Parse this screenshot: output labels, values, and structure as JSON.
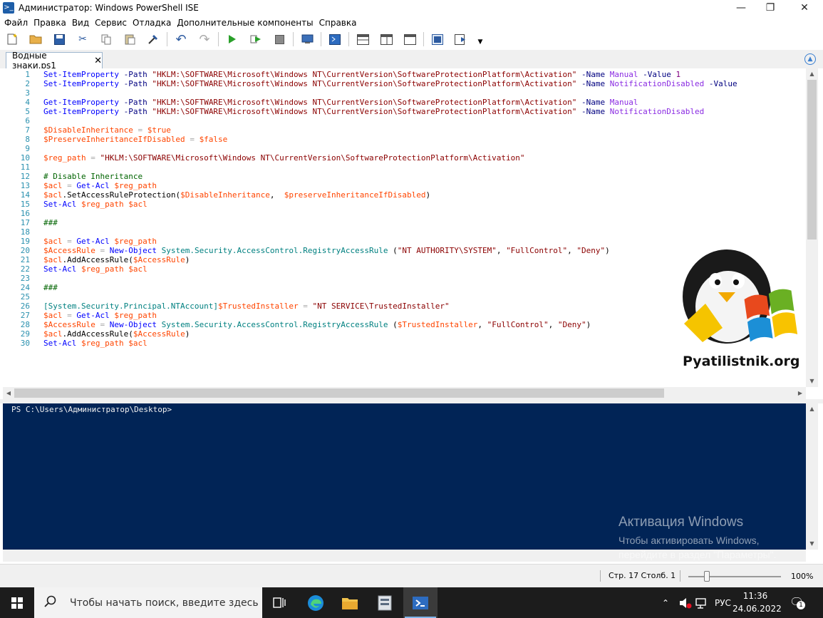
{
  "window": {
    "title": "Администратор: Windows PowerShell ISE",
    "icon": "powershell-icon",
    "controls": [
      "minimize",
      "maximize",
      "close"
    ]
  },
  "menu": [
    "Файл",
    "Правка",
    "Вид",
    "Сервис",
    "Отладка",
    "Дополнительные компоненты",
    "Справка"
  ],
  "toolbar": {
    "buttons": [
      "new",
      "open",
      "save",
      "cut",
      "copy",
      "paste",
      "clear",
      "undo",
      "redo",
      "run",
      "run-selection",
      "stop",
      "remote-powershell",
      "start-powershell",
      "show-script-top",
      "show-script-right",
      "show-script-maximized",
      "show-commands",
      "show-addon"
    ]
  },
  "tab": {
    "label": "Водные знаки.ps1",
    "close": "✕"
  },
  "editor": {
    "lines": [
      {
        "n": "1",
        "tokens": [
          [
            "cmd",
            "Set-ItemProperty"
          ],
          [
            "txt",
            " "
          ],
          [
            "par",
            "-Path"
          ],
          [
            "txt",
            " "
          ],
          [
            "str",
            "\"HKLM:\\SOFTWARE\\Microsoft\\Windows NT\\CurrentVersion\\SoftwareProtectionPlatform\\Activation\""
          ],
          [
            "txt",
            " "
          ],
          [
            "par",
            "-Name"
          ],
          [
            "txt",
            " "
          ],
          [
            "arg",
            "Manual"
          ],
          [
            "txt",
            " "
          ],
          [
            "par",
            "-Value"
          ],
          [
            "txt",
            " "
          ],
          [
            "num",
            "1"
          ]
        ]
      },
      {
        "n": "2",
        "tokens": [
          [
            "cmd",
            "Set-ItemProperty"
          ],
          [
            "txt",
            " "
          ],
          [
            "par",
            "-Path"
          ],
          [
            "txt",
            " "
          ],
          [
            "str",
            "\"HKLM:\\SOFTWARE\\Microsoft\\Windows NT\\CurrentVersion\\SoftwareProtectionPlatform\\Activation\""
          ],
          [
            "txt",
            " "
          ],
          [
            "par",
            "-Name"
          ],
          [
            "txt",
            " "
          ],
          [
            "arg",
            "NotificationDisabled"
          ],
          [
            "txt",
            " "
          ],
          [
            "par",
            "-Value"
          ]
        ]
      },
      {
        "n": "3",
        "tokens": []
      },
      {
        "n": "4",
        "tokens": [
          [
            "cmd",
            "Get-ItemProperty"
          ],
          [
            "txt",
            " "
          ],
          [
            "par",
            "-Path"
          ],
          [
            "txt",
            " "
          ],
          [
            "str",
            "\"HKLM:\\SOFTWARE\\Microsoft\\Windows NT\\CurrentVersion\\SoftwareProtectionPlatform\\Activation\""
          ],
          [
            "txt",
            " "
          ],
          [
            "par",
            "-Name"
          ],
          [
            "txt",
            " "
          ],
          [
            "arg",
            "Manual"
          ]
        ]
      },
      {
        "n": "5",
        "tokens": [
          [
            "cmd",
            "Get-ItemProperty"
          ],
          [
            "txt",
            " "
          ],
          [
            "par",
            "-Path"
          ],
          [
            "txt",
            " "
          ],
          [
            "str",
            "\"HKLM:\\SOFTWARE\\Microsoft\\Windows NT\\CurrentVersion\\SoftwareProtectionPlatform\\Activation\""
          ],
          [
            "txt",
            " "
          ],
          [
            "par",
            "-Name"
          ],
          [
            "txt",
            " "
          ],
          [
            "arg",
            "NotificationDisabled"
          ]
        ]
      },
      {
        "n": "6",
        "tokens": []
      },
      {
        "n": "7",
        "tokens": [
          [
            "var",
            "$DisableInheritance"
          ],
          [
            "txt",
            " "
          ],
          [
            "op",
            "="
          ],
          [
            "txt",
            " "
          ],
          [
            "var",
            "$true"
          ]
        ]
      },
      {
        "n": "8",
        "tokens": [
          [
            "var",
            "$PreserveInheritanceIfDisabled"
          ],
          [
            "txt",
            " "
          ],
          [
            "op",
            "="
          ],
          [
            "txt",
            " "
          ],
          [
            "var",
            "$false"
          ]
        ]
      },
      {
        "n": "9",
        "tokens": []
      },
      {
        "n": "10",
        "tokens": [
          [
            "var",
            "$reg_path"
          ],
          [
            "txt",
            " "
          ],
          [
            "op",
            "="
          ],
          [
            "txt",
            " "
          ],
          [
            "str",
            "\"HKLM:\\SOFTWARE\\Microsoft\\Windows NT\\CurrentVersion\\SoftwareProtectionPlatform\\Activation\""
          ]
        ]
      },
      {
        "n": "11",
        "tokens": []
      },
      {
        "n": "12",
        "tokens": [
          [
            "cmt",
            "# Disable Inheritance"
          ]
        ]
      },
      {
        "n": "13",
        "tokens": [
          [
            "var",
            "$acl"
          ],
          [
            "txt",
            " "
          ],
          [
            "op",
            "="
          ],
          [
            "txt",
            " "
          ],
          [
            "cmd",
            "Get-Acl"
          ],
          [
            "txt",
            " "
          ],
          [
            "var",
            "$reg_path"
          ]
        ]
      },
      {
        "n": "14",
        "tokens": [
          [
            "var",
            "$acl"
          ],
          [
            "txt",
            ".SetAccessRuleProtection("
          ],
          [
            "var",
            "$DisableInheritance"
          ],
          [
            "txt",
            ",  "
          ],
          [
            "var",
            "$preserveInheritanceIfDisabled"
          ],
          [
            "txt",
            ")"
          ]
        ]
      },
      {
        "n": "15",
        "tokens": [
          [
            "cmd",
            "Set-Acl"
          ],
          [
            "txt",
            " "
          ],
          [
            "var",
            "$reg_path"
          ],
          [
            "txt",
            " "
          ],
          [
            "var",
            "$acl"
          ]
        ]
      },
      {
        "n": "16",
        "tokens": []
      },
      {
        "n": "17",
        "tokens": [
          [
            "cmt",
            "###"
          ]
        ]
      },
      {
        "n": "18",
        "tokens": []
      },
      {
        "n": "19",
        "tokens": [
          [
            "var",
            "$acl"
          ],
          [
            "txt",
            " "
          ],
          [
            "op",
            "="
          ],
          [
            "txt",
            " "
          ],
          [
            "cmd",
            "Get-Acl"
          ],
          [
            "txt",
            " "
          ],
          [
            "var",
            "$reg_path"
          ]
        ]
      },
      {
        "n": "20",
        "tokens": [
          [
            "var",
            "$AccessRule"
          ],
          [
            "txt",
            " "
          ],
          [
            "op",
            "="
          ],
          [
            "txt",
            " "
          ],
          [
            "cmd",
            "New-Object"
          ],
          [
            "txt",
            " "
          ],
          [
            "typ",
            "System.Security.AccessControl.RegistryAccessRule"
          ],
          [
            "txt",
            " ("
          ],
          [
            "str",
            "\"NT AUTHORITY\\SYSTEM\""
          ],
          [
            "txt",
            ", "
          ],
          [
            "str",
            "\"FullControl\""
          ],
          [
            "txt",
            ", "
          ],
          [
            "str",
            "\"Deny\""
          ],
          [
            "txt",
            ")"
          ]
        ]
      },
      {
        "n": "21",
        "tokens": [
          [
            "var",
            "$acl"
          ],
          [
            "txt",
            ".AddAccessRule("
          ],
          [
            "var",
            "$AccessRule"
          ],
          [
            "txt",
            ")"
          ]
        ]
      },
      {
        "n": "22",
        "tokens": [
          [
            "cmd",
            "Set-Acl"
          ],
          [
            "txt",
            " "
          ],
          [
            "var",
            "$reg_path"
          ],
          [
            "txt",
            " "
          ],
          [
            "var",
            "$acl"
          ]
        ]
      },
      {
        "n": "23",
        "tokens": []
      },
      {
        "n": "24",
        "tokens": [
          [
            "cmt",
            "###"
          ]
        ]
      },
      {
        "n": "25",
        "tokens": []
      },
      {
        "n": "26",
        "tokens": [
          [
            "typ",
            "[System.Security.Principal.NTAccount]"
          ],
          [
            "var",
            "$TrustedInstaller"
          ],
          [
            "txt",
            " "
          ],
          [
            "op",
            "="
          ],
          [
            "txt",
            " "
          ],
          [
            "str",
            "\"NT SERVICE\\TrustedInstaller\""
          ]
        ]
      },
      {
        "n": "27",
        "tokens": [
          [
            "var",
            "$acl"
          ],
          [
            "txt",
            " "
          ],
          [
            "op",
            "="
          ],
          [
            "txt",
            " "
          ],
          [
            "cmd",
            "Get-Acl"
          ],
          [
            "txt",
            " "
          ],
          [
            "var",
            "$reg_path"
          ]
        ]
      },
      {
        "n": "28",
        "tokens": [
          [
            "var",
            "$AccessRule"
          ],
          [
            "txt",
            " "
          ],
          [
            "op",
            "="
          ],
          [
            "txt",
            " "
          ],
          [
            "cmd",
            "New-Object"
          ],
          [
            "txt",
            " "
          ],
          [
            "typ",
            "System.Security.AccessControl.RegistryAccessRule"
          ],
          [
            "txt",
            " ("
          ],
          [
            "var",
            "$TrustedInstaller"
          ],
          [
            "txt",
            ", "
          ],
          [
            "str",
            "\"FullControl\""
          ],
          [
            "txt",
            ", "
          ],
          [
            "str",
            "\"Deny\""
          ],
          [
            "txt",
            ")"
          ]
        ]
      },
      {
        "n": "29",
        "tokens": [
          [
            "var",
            "$acl"
          ],
          [
            "txt",
            ".AddAccessRule("
          ],
          [
            "var",
            "$AccessRule"
          ],
          [
            "txt",
            ")"
          ]
        ]
      },
      {
        "n": "30",
        "tokens": [
          [
            "cmd",
            "Set-Acl"
          ],
          [
            "txt",
            " "
          ],
          [
            "var",
            "$reg_path"
          ],
          [
            "txt",
            " "
          ],
          [
            "var",
            "$acl"
          ]
        ]
      }
    ]
  },
  "console": {
    "prompt": "PS C:\\Users\\Администратор\\Desktop>"
  },
  "watermark": {
    "title": "Активация Windows",
    "line1": "Чтобы активировать Windows,",
    "line2": "перейдите в раздел \"Параметры\"."
  },
  "logo_text": "Pyatilistnik.org",
  "status": {
    "position": "Стр. 17  Столб. 1",
    "zoom": "100%",
    "zoom_level_percent": 100
  },
  "taskbar": {
    "search_placeholder": "Чтобы начать поиск, введите здесь",
    "language": "РУС",
    "time": "11:36",
    "date": "24.06.2022",
    "notification_count": "1"
  },
  "colors": {
    "console_bg": "#012456",
    "cmdlet": "#0000ff",
    "string": "#8b0000",
    "variable": "#ff4500",
    "comment": "#006400"
  }
}
